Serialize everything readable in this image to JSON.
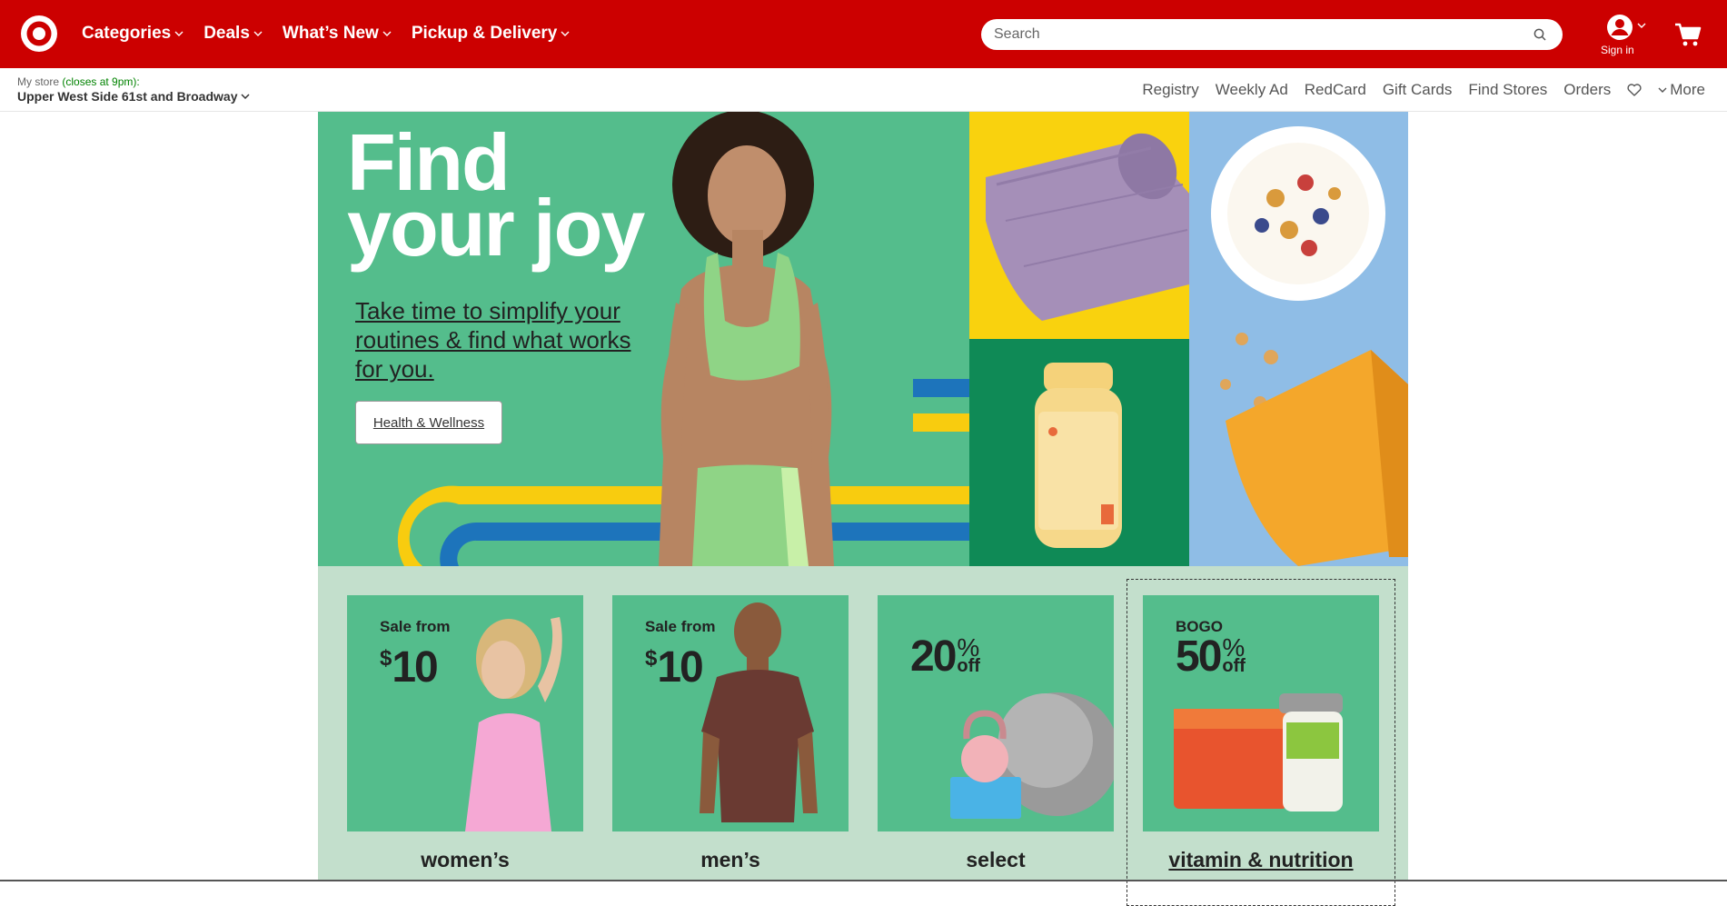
{
  "colors": {
    "brand_red": "#cc0000",
    "hero_green": "#54bd8c",
    "promo_bg": "#c3dfcc"
  },
  "header": {
    "nav": [
      {
        "label": "Categories"
      },
      {
        "label": "Deals"
      },
      {
        "label": "What’s New"
      },
      {
        "label": "Pickup & Delivery"
      }
    ],
    "search": {
      "placeholder": "Search"
    },
    "account_label": "Sign in"
  },
  "store": {
    "prefix": "My store",
    "hours": "(closes at 9pm):",
    "name": "Upper West Side 61st and Broadway"
  },
  "utility_links": [
    "Registry",
    "Weekly Ad",
    "RedCard",
    "Gift Cards",
    "Find Stores",
    "Orders"
  ],
  "more_label": "More",
  "hero": {
    "title_line1": "Find",
    "title_line2": "your joy",
    "subtitle": "Take time to simplify your routines & find what works for you.",
    "cta": "Health & Wellness"
  },
  "promos": [
    {
      "pre": "Sale from",
      "currency": "$",
      "amount": "10",
      "label": "women’s"
    },
    {
      "pre": "Sale from",
      "currency": "$",
      "amount": "10",
      "label": "men’s"
    },
    {
      "pre": "",
      "amount": "20",
      "pct": "%",
      "off": "off",
      "label": "select"
    },
    {
      "pre": "BOGO",
      "amount": "50",
      "pct": "%",
      "off": "off",
      "label": "vitamin & nutrition"
    }
  ]
}
